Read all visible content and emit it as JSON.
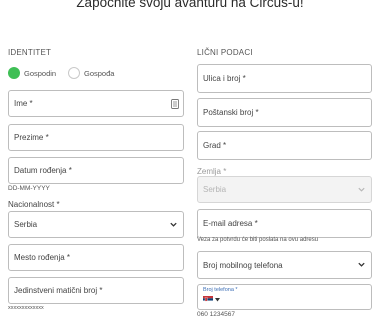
{
  "page": {
    "title": "Započnite svoju avanturu na Circus-u!"
  },
  "identity": {
    "heading": "IDENTITET",
    "gender": {
      "options": [
        "Gospodin",
        "Gospođa"
      ],
      "selected": "Gospodin"
    },
    "first_name": "Ime *",
    "last_name": "Prezime *",
    "birth_date": "Datum rođenja *",
    "birth_date_hint": "DD-MM-YYYY",
    "nationality_label": "Nacionalnost *",
    "nationality_value": "Serbia",
    "birthplace": "Mesto rođenja *",
    "personal_id": "Jedinstveni matični broj *",
    "personal_id_hint": "xxxxxxxxxxxxx"
  },
  "personal": {
    "heading": "LIČNI PODACI",
    "street": "Ulica i broj *",
    "postal_code": "Poštanski broj *",
    "city": "Grad *",
    "country_label": "Zemlja *",
    "country_value": "Serbia",
    "email": "E-mail adresa *",
    "email_hint": "Veza za potvrdu će biti poslata na ovu adresu",
    "phone_type": "Broj mobilnog telefona",
    "phone_label": "Broj telefona *",
    "phone_example": "060 1234567"
  },
  "colors": {
    "accent_green": "#3fbf55",
    "phone_label_blue": "#3d6fb6"
  },
  "icons": [
    "keyboard-icon",
    "chevron-down-icon",
    "serbia-flag-icon",
    "caret-down-icon"
  ]
}
